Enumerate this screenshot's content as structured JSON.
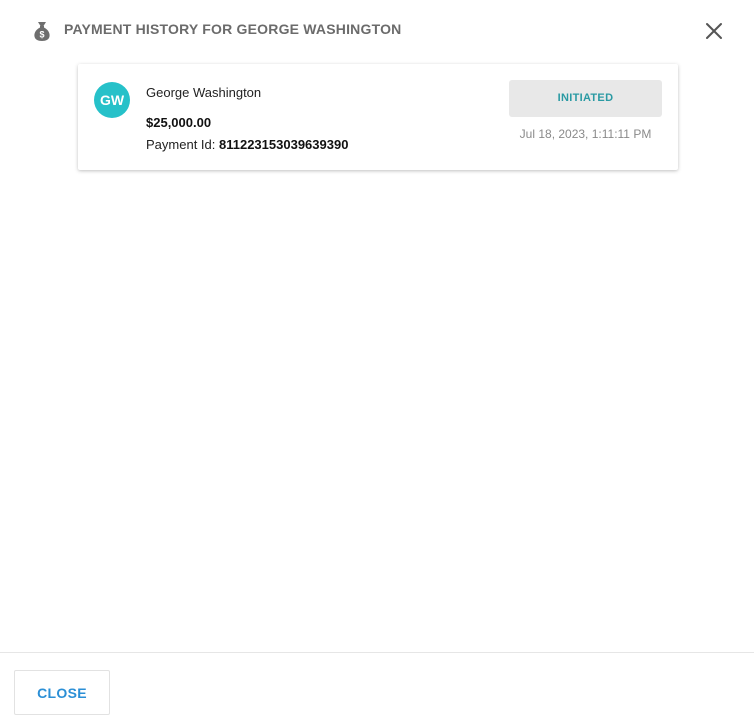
{
  "header": {
    "title": "PAYMENT HISTORY FOR GEORGE WASHINGTON",
    "icon": "money-bag-icon",
    "close_icon": "close-icon"
  },
  "payments": [
    {
      "avatar_initials": "GW",
      "payer_name": "George Washington",
      "amount": "$25,000.00",
      "payment_id_label": "Payment Id:",
      "payment_id": "811223153039639390",
      "status": "INITIATED",
      "timestamp": "Jul 18, 2023, 1:11:11 PM"
    }
  ],
  "footer": {
    "close_label": "CLOSE"
  },
  "colors": {
    "avatar_bg": "#26c1c9",
    "status_text": "#2a9aa3",
    "status_bg": "#e8e8e8",
    "close_button_text": "#2b8fd6",
    "header_title": "#6b6b6b"
  }
}
